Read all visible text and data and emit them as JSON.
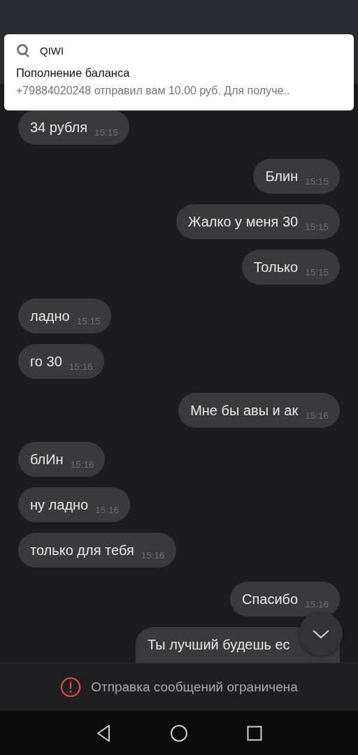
{
  "notification": {
    "app": "QIWI",
    "title": "Пополнение баланса",
    "text": "+79884020248 отправил вам 10.00 руб. Для получе.."
  },
  "messages": [
    {
      "kind": "incoming",
      "text": "34 рубля",
      "time": "15:15"
    },
    {
      "kind": "outgoing",
      "text": "Блин",
      "time": "15:15"
    },
    {
      "kind": "outgoing",
      "text": "Жалко у меня 30",
      "time": "15:15"
    },
    {
      "kind": "outgoing",
      "text": "Только",
      "time": "15:15"
    },
    {
      "kind": "incoming",
      "text": "ладно",
      "time": "15:15"
    },
    {
      "kind": "incoming",
      "text": "го 30",
      "time": "15:16"
    },
    {
      "kind": "outgoing",
      "text": "Мне бы авы и ак",
      "time": "15:16"
    },
    {
      "kind": "incoming",
      "text": "блИн",
      "time": "15:16"
    },
    {
      "kind": "incoming",
      "text": "ну ладно",
      "time": "15:16"
    },
    {
      "kind": "incoming",
      "text": "только для тебя",
      "time": "15:16"
    },
    {
      "kind": "outgoing",
      "text": "Спасибо",
      "time": "15:16"
    },
    {
      "kind": "outgoing",
      "text": "Ты лучший будешь ес"
    }
  ],
  "footer": {
    "text": "Отправка сообщений ограничена"
  }
}
